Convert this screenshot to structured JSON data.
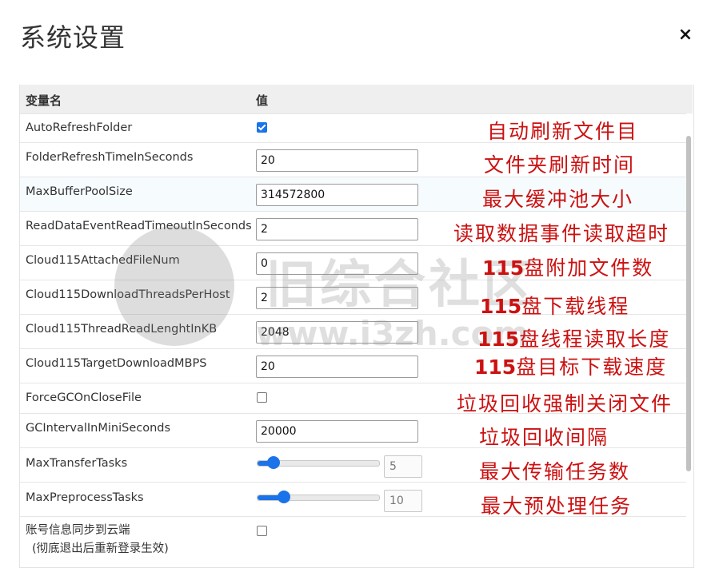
{
  "dialog": {
    "title": "系统设置",
    "close_glyph": "×"
  },
  "table": {
    "col_name": "变量名",
    "col_value": "值",
    "rows": [
      {
        "name": "AutoRefreshFolder",
        "type": "checkbox",
        "checked": true,
        "note": "自动刷新文件目"
      },
      {
        "name": "FolderRefreshTimeInSeconds",
        "type": "text",
        "value": "20",
        "note": "文件夹刷新时间"
      },
      {
        "name": "MaxBufferPoolSize",
        "type": "text",
        "value": "314572800",
        "note": "最大缓冲池大小"
      },
      {
        "name": "ReadDataEventReadTimeoutInSeconds",
        "type": "text",
        "value": "2",
        "note": "读取数据事件读取超时"
      },
      {
        "name": "Cloud115AttachedFileNum",
        "type": "text",
        "value": "0",
        "note_num": "115",
        "note": "盘附加文件数"
      },
      {
        "name": "Cloud115DownloadThreadsPerHost",
        "type": "text",
        "value": "2",
        "note_num": "115",
        "note": "盘下载线程"
      },
      {
        "name": "Cloud115ThreadReadLenghtInKB",
        "type": "text",
        "value": "2048",
        "note_num": "115",
        "note": "盘线程读取长度"
      },
      {
        "name": "Cloud115TargetDownloadMBPS",
        "type": "text",
        "value": "20",
        "note_num": "115",
        "note": "盘目标下载速度"
      },
      {
        "name": "ForceGCOnCloseFile",
        "type": "checkbox",
        "checked": false,
        "note": "垃圾回收强制关闭文件"
      },
      {
        "name": "GCIntervalInMiniSeconds",
        "type": "text",
        "value": "20000",
        "note": "垃圾回收间隔"
      },
      {
        "name": "MaxTransferTasks",
        "type": "slider",
        "value": "5",
        "fraction": 0.13,
        "note": "最大传输任务数"
      },
      {
        "name": "MaxPreprocessTasks",
        "type": "slider",
        "value": "10",
        "fraction": 0.22,
        "note": "最大预处理任务"
      },
      {
        "name": "账号信息同步到云端",
        "sub": "(彻底退出后重新登录生效)",
        "type": "checkbox",
        "checked": false
      }
    ]
  },
  "watermark": {
    "text": "旧综合社区",
    "url": "www.i3zh.com"
  },
  "colors": {
    "accent": "#1a73e8",
    "note": "#cc1111",
    "header_bg": "#efefef"
  }
}
